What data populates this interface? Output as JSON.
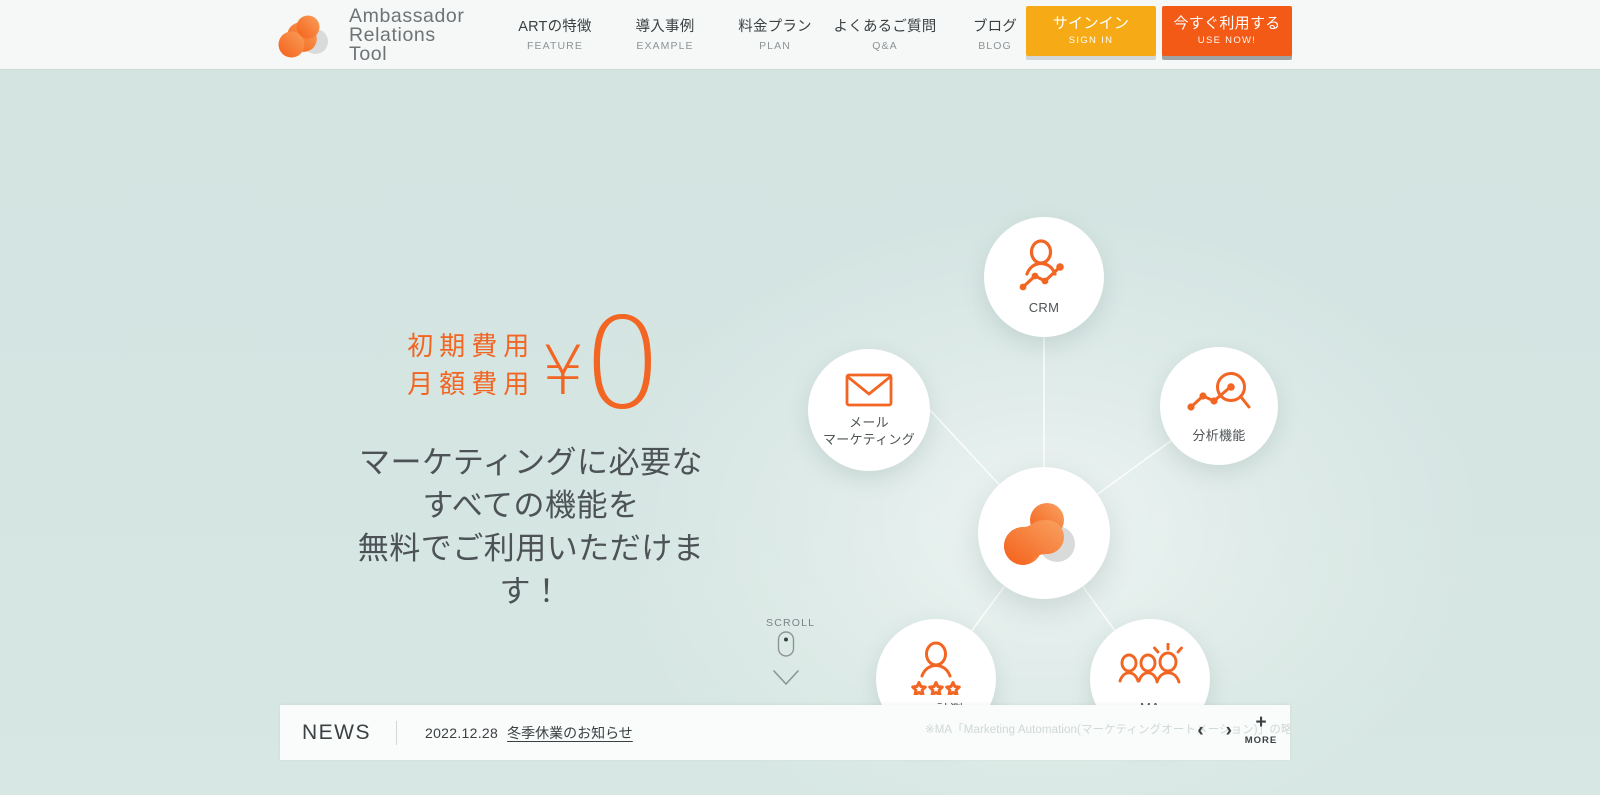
{
  "header": {
    "logo": {
      "name": "Ambassador Relations Tool",
      "text": "Ambassador\nRelations\nTool",
      "orange": "#f47721",
      "gray": "#d7d8d8"
    },
    "nav": [
      {
        "jp": "ARTの特徴",
        "en": "FEATURE"
      },
      {
        "jp": "導入事例",
        "en": "EXAMPLE"
      },
      {
        "jp": "料金プラン",
        "en": "PLAN"
      },
      {
        "jp": "よくあるご質問",
        "en": "Q&A"
      },
      {
        "jp": "ブログ",
        "en": "BLOG"
      }
    ],
    "cta": [
      {
        "jp": "サインイン",
        "en": "SIGN IN",
        "color": "#f6ab16"
      },
      {
        "jp": "今すぐ利用する",
        "en": "USE NOW!",
        "color": "#f35a15"
      }
    ]
  },
  "hero": {
    "background_color": "#d3e4e1",
    "accent_color": "#f26522",
    "price": {
      "label_line1": "初期費用",
      "label_line2": "月額費用",
      "currency": "¥",
      "amount": "0"
    },
    "tagline": "マーケティングに必要な\nすべての機能を\n無料でご利用いただけます！",
    "scroll": {
      "label": "SCROLL"
    },
    "diagram": {
      "center": {
        "name": "art-logo-hub",
        "icon": "art-logo-icon"
      },
      "nodes": [
        {
          "id": "crm",
          "label": "CRM",
          "icon": "person-chart-icon"
        },
        {
          "id": "analytics",
          "label": "分析機能",
          "icon": "magnifier-chart-icon"
        },
        {
          "id": "ma",
          "label": "MA",
          "icon": "people-group-icon"
        },
        {
          "id": "nps",
          "label": "NPS計測",
          "icon": "person-stars-icon"
        },
        {
          "id": "mail",
          "label": "メール\nマーケティング",
          "icon": "envelope-icon"
        }
      ]
    }
  },
  "news": {
    "label": "NEWS",
    "date": "2022.12.28",
    "title": "冬季休業のお知らせ",
    "note": "※MA「Marketing Automation(マーケティングオートメーション)」の略",
    "prev": "‹",
    "next": "›",
    "more_plus": "+",
    "more_label": "MORE"
  }
}
